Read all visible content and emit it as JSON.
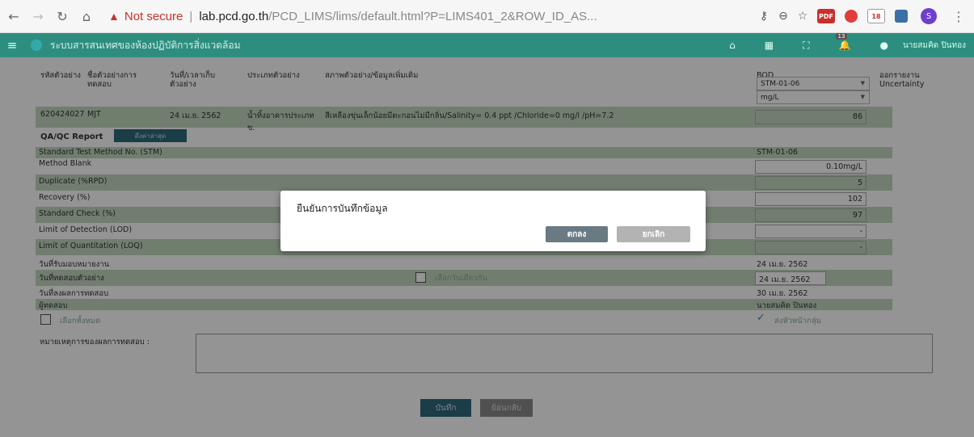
{
  "browser": {
    "not_secure": "Not secure",
    "separator": "|",
    "url_host": "lab.pcd.go.th",
    "url_path": "/PCD_LIMS/lims/default.html?P=LIMS401_2&ROW_ID_AS...",
    "calendar_day": "18",
    "profile_initial": "S",
    "pdf_label": "PDF"
  },
  "app": {
    "title": "ระบบสารสนเทศของห้องปฏิบัติการสิ่งแวดล้อม",
    "notification_count": "13",
    "user_name": "นายสมคิด ปินทอง"
  },
  "table": {
    "headers": {
      "sample_code": "รหัสตัวอย่าง",
      "project": "ชื่อตัวอย่างการทดสอบ",
      "collected": "วันที่/เวลาเก็บตัวอย่าง",
      "sample_type": "ประเภทตัวอย่าง",
      "condition": "สภาพตัวอย่าง/ข้อมูลเพิ่มเติม",
      "param": "BOD",
      "report": "ออกรายงาน Uncertainty"
    },
    "method_select": "STM-01-06",
    "unit_select": "mg/L",
    "row": {
      "sample_code": "620424027",
      "project": "MJT",
      "collected": "24 เม.ย. 2562",
      "sample_type": "น้ำทิ้งอาคารประเภท ข.",
      "condition": "สีเหลืองขุ่นเล็กน้อยมีตะกอนไม่มีกลิ่น/Salinity= 0.4 ppt /Chloride=0 mg/l /pH=7.2",
      "value": "86"
    }
  },
  "qa": {
    "label": "QA/QC Report",
    "latest_button": "ดึงค่าล่าสุด",
    "rows": [
      {
        "label": "Standard Test Method No. (STM)",
        "value": "STM-01-06"
      },
      {
        "label": "Method Blank",
        "value": "0.10mg/L"
      },
      {
        "label": "Duplicate (%RPD)",
        "value": "5"
      },
      {
        "label": "Recovery (%)",
        "value": "102"
      },
      {
        "label": "Standard Check (%)",
        "value": "97"
      },
      {
        "label": "Limit of Detection (LOD)",
        "value": "-"
      },
      {
        "label": "Limit of Quantitation (LOQ)",
        "value": "-"
      },
      {
        "label": "วันที่รับมอบหมายงาน",
        "value": "24 เม.ย. 2562"
      },
      {
        "label": "วันที่ทดสอบตัวอย่าง",
        "value": "24 เม.ย. 2562"
      },
      {
        "label": "วันที่ลงผลการทดสอบ",
        "value": "30 เม.ย. 2562"
      },
      {
        "label": "ผู้ทดสอบ",
        "value": "นายสมคิด ปินทอง"
      }
    ],
    "same_day_checkbox": "เลือกวันเดียวกัน",
    "select_all": "เลือกทั้งหมด",
    "send_to_head": "ส่งหัวหน้ากลุ่ม"
  },
  "notes_label": "หมายเหตุการของผลการทดสอบ :",
  "footer": {
    "save": "บันทึก",
    "back": "ย้อนกลับ"
  },
  "modal": {
    "title": "ยืนยันการบันทึกข้อมูล",
    "ok": "ตกลง",
    "cancel": "ยกเลิก"
  }
}
